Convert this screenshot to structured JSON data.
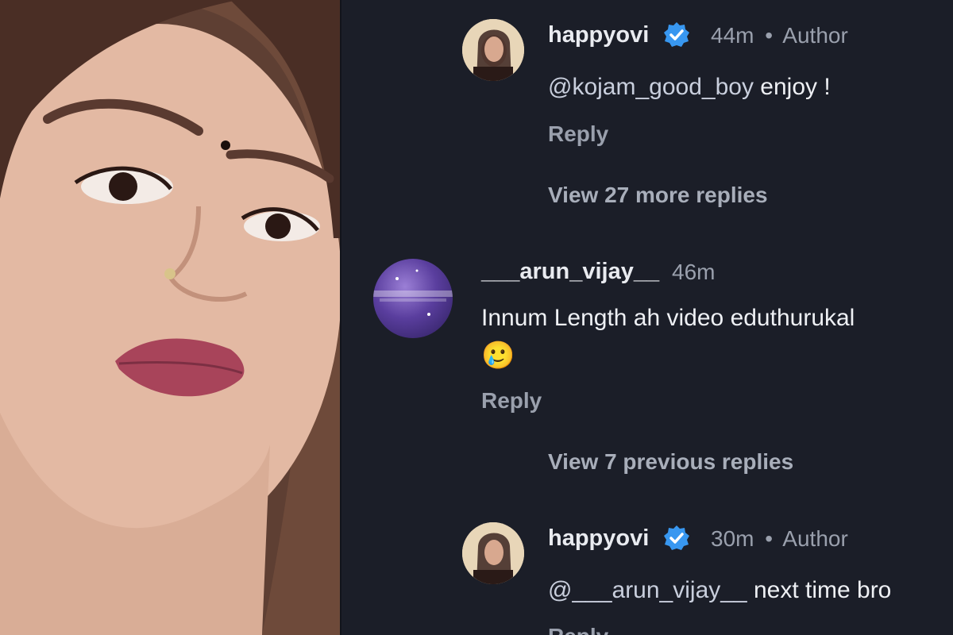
{
  "comments": [
    {
      "username": "happyovi",
      "time": "44m",
      "tag": "Author",
      "mention": "@kojam_good_boy",
      "text": " enjoy !",
      "reply_label": "Reply"
    },
    {
      "username": "___arun_vijay__",
      "time": "46m",
      "text": "Innum Length ah video eduthurukal",
      "emoji": "🥲",
      "reply_label": "Reply"
    },
    {
      "username": "happyovi",
      "time": "30m",
      "tag": "Author",
      "mention": "@___arun_vijay__",
      "text": " next time bro",
      "reply_label": "Reply"
    }
  ],
  "view_more": "View 27 more replies",
  "view_previous": "View 7 previous replies",
  "meta_separator": "•",
  "colors": {
    "background": "#1b1e28",
    "verified": "#3897f0",
    "text": "#eef0f4",
    "muted": "#9aa0ad"
  }
}
